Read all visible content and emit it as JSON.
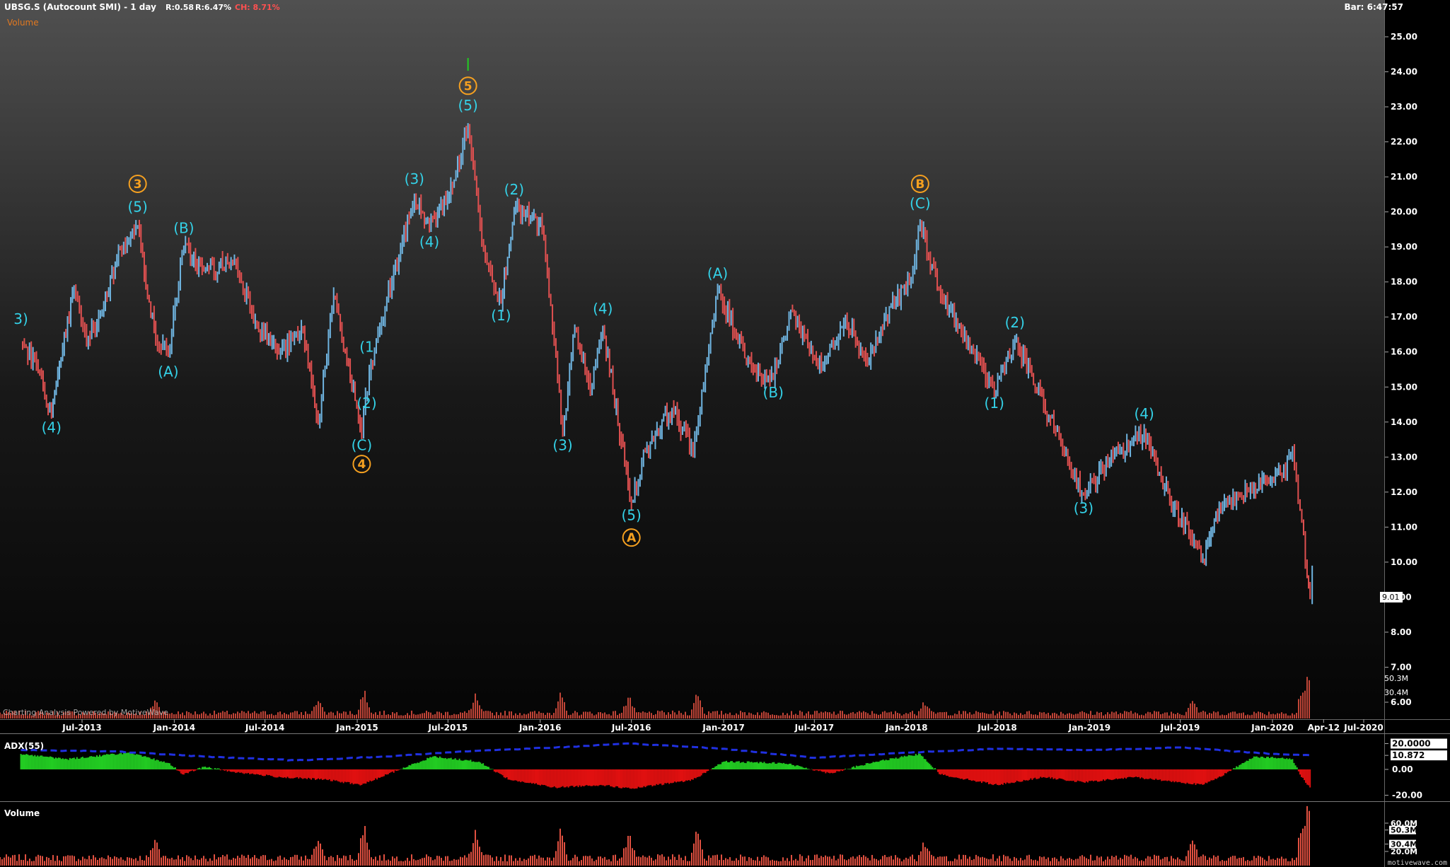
{
  "header": {
    "symbol_title": "UBSG.S (Autocount SMI) - 1 day",
    "r1": "R:0.58",
    "r2": "R:6.47%",
    "ch": "CH: 8.71%",
    "overlay_label": "Volume",
    "bar_time": "Bar: 6:47:57"
  },
  "watermark": "Charting Analysis Powered by MotiveWave",
  "site_mark": "motivewave.com",
  "colors": {
    "up_bar": "#6fb4e0",
    "down_bar": "#e05050",
    "wave_minor": "#34d2e8",
    "wave_major": "#f5a020",
    "adx_line": "#2030e0",
    "adx_pos": "#22cc22",
    "adx_neg": "#e01010",
    "volume_bar": "#e05040"
  },
  "chart_data": [
    {
      "type": "line",
      "title": "UBSG.S (Autocount SMI) - 1 day",
      "y_axis_ticks": [
        "25.00",
        "24.00",
        "23.00",
        "22.00",
        "21.00",
        "20.00",
        "19.00",
        "18.00",
        "17.00",
        "16.00",
        "15.00",
        "14.00",
        "13.00",
        "12.00",
        "11.00",
        "10.00",
        "9.00",
        "8.00",
        "7.00",
        "6.00"
      ],
      "ylim": [
        5.5,
        25.5
      ],
      "x_axis_ticks": [
        "Jul-2013",
        "Jan-2014",
        "Jul-2014",
        "Jan-2015",
        "Jul-2015",
        "Jan-2016",
        "Jul-2016",
        "Jan-2017",
        "Jul-2017",
        "Jan-2018",
        "Jul-2018",
        "Jan-2019",
        "Jul-2019",
        "Jan-2020",
        "Apr-12",
        "Jul-2020"
      ],
      "last_price_label": "9.01",
      "price_path": [
        {
          "x": "2013-03-01",
          "y": 16.3
        },
        {
          "x": "2013-04-01",
          "y": 15.6
        },
        {
          "x": "2013-05-01",
          "y": 14.2
        },
        {
          "x": "2013-05-20",
          "y": 15.8
        },
        {
          "x": "2013-06-15",
          "y": 17.8
        },
        {
          "x": "2013-07-10",
          "y": 16.2
        },
        {
          "x": "2013-08-10",
          "y": 17.2
        },
        {
          "x": "2013-09-15",
          "y": 19.0
        },
        {
          "x": "2013-10-20",
          "y": 19.6
        },
        {
          "x": "2013-11-25",
          "y": 16.3
        },
        {
          "x": "2013-12-20",
          "y": 16.0
        },
        {
          "x": "2014-01-20",
          "y": 19.0
        },
        {
          "x": "2014-03-01",
          "y": 18.3
        },
        {
          "x": "2014-05-01",
          "y": 18.6
        },
        {
          "x": "2014-06-15",
          "y": 16.8
        },
        {
          "x": "2014-08-01",
          "y": 16.0
        },
        {
          "x": "2014-09-15",
          "y": 16.6
        },
        {
          "x": "2014-10-15",
          "y": 14.0
        },
        {
          "x": "2014-11-15",
          "y": 17.6
        },
        {
          "x": "2015-01-10",
          "y": 13.7
        },
        {
          "x": "2015-01-25",
          "y": 15.4
        },
        {
          "x": "2015-03-01",
          "y": 17.5
        },
        {
          "x": "2015-04-25",
          "y": 20.4
        },
        {
          "x": "2015-05-25",
          "y": 19.6
        },
        {
          "x": "2015-07-10",
          "y": 20.7
        },
        {
          "x": "2015-08-10",
          "y": 22.5
        },
        {
          "x": "2015-09-10",
          "y": 19.0
        },
        {
          "x": "2015-10-15",
          "y": 17.4
        },
        {
          "x": "2015-11-10",
          "y": 20.1
        },
        {
          "x": "2016-01-05",
          "y": 19.6
        },
        {
          "x": "2016-02-15",
          "y": 13.7
        },
        {
          "x": "2016-03-10",
          "y": 16.7
        },
        {
          "x": "2016-04-10",
          "y": 14.9
        },
        {
          "x": "2016-05-05",
          "y": 16.7
        },
        {
          "x": "2016-07-01",
          "y": 11.7
        },
        {
          "x": "2016-08-01",
          "y": 13.3
        },
        {
          "x": "2016-09-20",
          "y": 14.4
        },
        {
          "x": "2016-11-01",
          "y": 13.2
        },
        {
          "x": "2016-12-20",
          "y": 17.7
        },
        {
          "x": "2017-03-01",
          "y": 15.5
        },
        {
          "x": "2017-04-10",
          "y": 15.2
        },
        {
          "x": "2017-05-15",
          "y": 17.2
        },
        {
          "x": "2017-07-15",
          "y": 15.5
        },
        {
          "x": "2017-09-01",
          "y": 17.0
        },
        {
          "x": "2017-10-15",
          "y": 15.7
        },
        {
          "x": "2017-12-01",
          "y": 17.3
        },
        {
          "x": "2018-01-10",
          "y": 18.0
        },
        {
          "x": "2018-01-28",
          "y": 19.7
        },
        {
          "x": "2018-03-10",
          "y": 17.6
        },
        {
          "x": "2018-04-20",
          "y": 16.6
        },
        {
          "x": "2018-06-25",
          "y": 14.9
        },
        {
          "x": "2018-08-05",
          "y": 16.3
        },
        {
          "x": "2018-10-15",
          "y": 14.1
        },
        {
          "x": "2018-12-20",
          "y": 11.9
        },
        {
          "x": "2019-02-10",
          "y": 12.9
        },
        {
          "x": "2019-04-20",
          "y": 13.7
        },
        {
          "x": "2019-06-10",
          "y": 11.8
        },
        {
          "x": "2019-08-15",
          "y": 10.1
        },
        {
          "x": "2019-09-20",
          "y": 11.5
        },
        {
          "x": "2019-11-25",
          "y": 12.2
        },
        {
          "x": "2020-01-20",
          "y": 12.5
        },
        {
          "x": "2020-02-10",
          "y": 13.2
        },
        {
          "x": "2020-02-25",
          "y": 11.5
        },
        {
          "x": "2020-03-10",
          "y": 9.6
        },
        {
          "x": "2020-03-16",
          "y": 9.01
        }
      ],
      "wave_labels": [
        {
          "text": "3)",
          "x": "2013-03-01",
          "y": 16.8,
          "degree": "minor"
        },
        {
          "text": "(4)",
          "x": "2013-05-01",
          "y": 13.7,
          "degree": "minor"
        },
        {
          "text": "(5)",
          "x": "2013-10-20",
          "y": 20.0,
          "degree": "minor"
        },
        {
          "text": "3",
          "x": "2013-10-20",
          "y": 20.7,
          "degree": "major"
        },
        {
          "text": "(A)",
          "x": "2013-12-20",
          "y": 15.3,
          "degree": "minor"
        },
        {
          "text": "(B)",
          "x": "2014-01-20",
          "y": 19.4,
          "degree": "minor"
        },
        {
          "text": "(1",
          "x": "2015-01-20",
          "y": 16.0,
          "degree": "minor"
        },
        {
          "text": "(2)",
          "x": "2015-01-20",
          "y": 14.4,
          "degree": "minor"
        },
        {
          "text": "(C)",
          "x": "2015-01-10",
          "y": 13.2,
          "degree": "minor"
        },
        {
          "text": "4",
          "x": "2015-01-10",
          "y": 12.7,
          "degree": "major"
        },
        {
          "text": "(3)",
          "x": "2015-04-25",
          "y": 20.8,
          "degree": "minor"
        },
        {
          "text": "(4)",
          "x": "2015-05-25",
          "y": 19.0,
          "degree": "minor"
        },
        {
          "text": "(5)",
          "x": "2015-08-10",
          "y": 22.9,
          "degree": "minor"
        },
        {
          "text": "5",
          "x": "2015-08-10",
          "y": 23.5,
          "degree": "major"
        },
        {
          "text": "(1)",
          "x": "2015-10-15",
          "y": 16.9,
          "degree": "minor"
        },
        {
          "text": "(2)",
          "x": "2015-11-10",
          "y": 20.5,
          "degree": "minor"
        },
        {
          "text": "(3)",
          "x": "2016-02-15",
          "y": 13.2,
          "degree": "minor"
        },
        {
          "text": "(4)",
          "x": "2016-05-05",
          "y": 17.1,
          "degree": "minor"
        },
        {
          "text": "(5)",
          "x": "2016-07-01",
          "y": 11.2,
          "degree": "minor"
        },
        {
          "text": "A",
          "x": "2016-07-01",
          "y": 10.6,
          "degree": "major"
        },
        {
          "text": "(A)",
          "x": "2016-12-20",
          "y": 18.1,
          "degree": "minor"
        },
        {
          "text": "(B)",
          "x": "2017-04-10",
          "y": 14.7,
          "degree": "minor"
        },
        {
          "text": "(C)",
          "x": "2018-01-28",
          "y": 20.1,
          "degree": "minor"
        },
        {
          "text": "B",
          "x": "2018-01-28",
          "y": 20.7,
          "degree": "major"
        },
        {
          "text": "(1)",
          "x": "2018-06-25",
          "y": 14.4,
          "degree": "minor"
        },
        {
          "text": "(2)",
          "x": "2018-08-05",
          "y": 16.7,
          "degree": "minor"
        },
        {
          "text": "(3)",
          "x": "2018-12-20",
          "y": 11.4,
          "degree": "minor"
        },
        {
          "text": "(4)",
          "x": "2019-04-20",
          "y": 14.1,
          "degree": "minor"
        }
      ]
    },
    {
      "type": "area",
      "title": "ADX(55)",
      "y_axis_ticks": [
        "20.0000",
        "10.872",
        "0.00",
        "-20.00"
      ],
      "ylim": [
        -22,
        22
      ],
      "last_value": 10.872,
      "histogram": [
        {
          "x": "2013-03-01",
          "y": 12
        },
        {
          "x": "2013-06-01",
          "y": 8
        },
        {
          "x": "2013-10-01",
          "y": 13
        },
        {
          "x": "2013-12-20",
          "y": 5
        },
        {
          "x": "2014-01-20",
          "y": -4
        },
        {
          "x": "2014-03-01",
          "y": 2
        },
        {
          "x": "2014-05-01",
          "y": -2
        },
        {
          "x": "2014-08-01",
          "y": -6
        },
        {
          "x": "2014-11-01",
          "y": -8
        },
        {
          "x": "2015-01-10",
          "y": -12
        },
        {
          "x": "2015-03-01",
          "y": -4
        },
        {
          "x": "2015-06-01",
          "y": 10
        },
        {
          "x": "2015-09-01",
          "y": 6
        },
        {
          "x": "2015-11-01",
          "y": -8
        },
        {
          "x": "2016-02-01",
          "y": -14
        },
        {
          "x": "2016-05-01",
          "y": -12
        },
        {
          "x": "2016-07-01",
          "y": -15
        },
        {
          "x": "2016-11-01",
          "y": -8
        },
        {
          "x": "2017-01-01",
          "y": 6
        },
        {
          "x": "2017-05-01",
          "y": 5
        },
        {
          "x": "2017-08-01",
          "y": -3
        },
        {
          "x": "2017-11-01",
          "y": 6
        },
        {
          "x": "2018-01-28",
          "y": 12
        },
        {
          "x": "2018-03-10",
          "y": -4
        },
        {
          "x": "2018-07-01",
          "y": -12
        },
        {
          "x": "2018-10-01",
          "y": -6
        },
        {
          "x": "2018-12-20",
          "y": -10
        },
        {
          "x": "2019-04-01",
          "y": -6
        },
        {
          "x": "2019-08-15",
          "y": -12
        },
        {
          "x": "2019-10-01",
          "y": -3
        },
        {
          "x": "2019-11-25",
          "y": 10
        },
        {
          "x": "2020-02-10",
          "y": 8
        },
        {
          "x": "2020-02-25",
          "y": -4
        },
        {
          "x": "2020-03-16",
          "y": -14
        }
      ],
      "adx_line": [
        {
          "x": "2013-03-01",
          "y": 15
        },
        {
          "x": "2013-09-01",
          "y": 14
        },
        {
          "x": "2014-03-01",
          "y": 10
        },
        {
          "x": "2014-09-01",
          "y": 7
        },
        {
          "x": "2015-03-01",
          "y": 10
        },
        {
          "x": "2015-08-01",
          "y": 14
        },
        {
          "x": "2016-02-01",
          "y": 17
        },
        {
          "x": "2016-07-01",
          "y": 20
        },
        {
          "x": "2017-01-01",
          "y": 16
        },
        {
          "x": "2017-07-01",
          "y": 9
        },
        {
          "x": "2018-01-01",
          "y": 13
        },
        {
          "x": "2018-07-01",
          "y": 16
        },
        {
          "x": "2019-01-01",
          "y": 15
        },
        {
          "x": "2019-07-01",
          "y": 17
        },
        {
          "x": "2020-01-01",
          "y": 12
        },
        {
          "x": "2020-03-16",
          "y": 11
        }
      ]
    },
    {
      "type": "bar",
      "title": "Volume",
      "y_axis_ticks": [
        "60.0M",
        "50.3M",
        "30.4M",
        "20.0M"
      ],
      "last_value_labels": [
        "50.3M",
        "30.4M"
      ],
      "ylim": [
        0,
        65
      ],
      "volume_peaks": [
        {
          "x": "2013-11-25",
          "y": 35
        },
        {
          "x": "2014-10-15",
          "y": 30
        },
        {
          "x": "2015-01-15",
          "y": 60
        },
        {
          "x": "2015-08-25",
          "y": 38
        },
        {
          "x": "2016-02-10",
          "y": 45
        },
        {
          "x": "2016-06-25",
          "y": 42
        },
        {
          "x": "2016-11-10",
          "y": 55
        },
        {
          "x": "2018-02-05",
          "y": 33
        },
        {
          "x": "2019-07-25",
          "y": 40
        },
        {
          "x": "2020-03-12",
          "y": 50
        }
      ]
    }
  ]
}
